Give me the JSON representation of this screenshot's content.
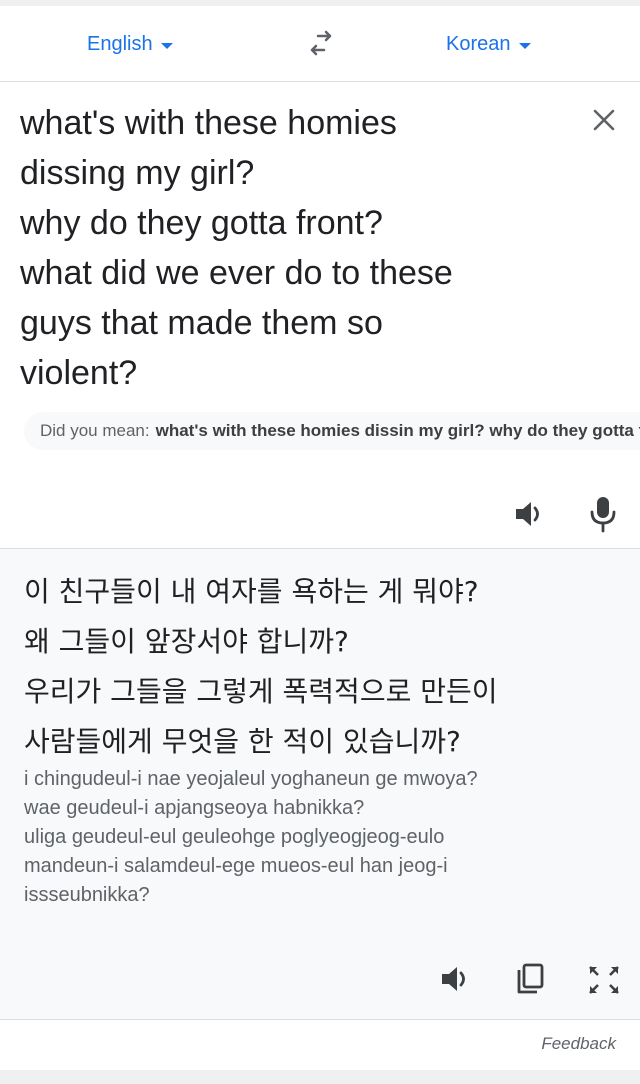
{
  "langbar": {
    "source_language": "English",
    "target_language": "Korean",
    "swap_icon": "swap-arrows-icon",
    "caret_icon": "caret-down-icon"
  },
  "source": {
    "lines": [
      "what's with these homies",
      "dissing my girl?",
      "why do they gotta front?",
      "what did we ever do to these",
      "guys that made them so",
      "violent?"
    ],
    "clear_icon": "close-icon",
    "did_you_mean_label": "Did you mean:",
    "did_you_mean_suggestion": "what's with these homies dissin my girl? why do they gotta front?",
    "speaker_icon": "speaker-icon",
    "mic_icon": "microphone-icon"
  },
  "translation": {
    "lines": [
      "이 친구들이 내 여자를 욕하는 게 뭐야?",
      "왜 그들이 앞장서야 합니까?",
      "우리가 그들을 그렇게 폭력적으로 만든이",
      "사람들에게 무엇을 한 적이 있습니까?"
    ],
    "romanization": [
      "i chingudeul-i nae yeojaleul yoghaneun ge mwoya?",
      "wae geudeul-i apjangseoya habnikka?",
      "uliga geudeul-eul geuleohge poglyeogjeog-eulo",
      "mandeun-i salamdeul-ege mueos-eul han jeog-i",
      "issseubnikka?"
    ],
    "speaker_icon": "speaker-icon",
    "copy_icon": "copy-icon",
    "fullscreen_icon": "fullscreen-icon"
  },
  "footer": {
    "feedback_label": "Feedback"
  },
  "colors": {
    "accent": "#1a73e8",
    "text": "#202124",
    "secondary_text": "#5f6368",
    "panel_background": "#f8f9fa",
    "divider": "#dadce0"
  }
}
